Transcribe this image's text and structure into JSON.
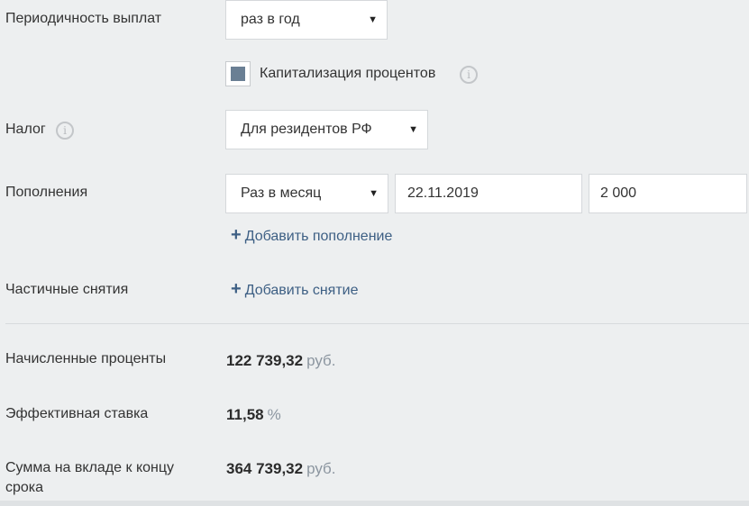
{
  "payout": {
    "label": "Периодичность выплат",
    "value": "раз в год"
  },
  "capitalization": {
    "label": "Капитализация процентов",
    "checked": true
  },
  "tax": {
    "label": "Налог",
    "value": "Для резидентов РФ"
  },
  "deposits": {
    "label": "Пополнения",
    "frequency": "Раз в месяц",
    "date": "22.11.2019",
    "amount": "2 000",
    "add_label": "Добавить пополнение"
  },
  "withdrawals": {
    "label": "Частичные снятия",
    "add_label": "Добавить снятие"
  },
  "results": {
    "interest": {
      "label": "Начисленные проценты",
      "value": "122 739,32",
      "unit": "руб."
    },
    "rate": {
      "label": "Эффективная ставка",
      "value": "11,58",
      "unit": "%"
    },
    "total": {
      "label_line1": "Сумма на вкладе к концу",
      "label_line2": "срока",
      "value": "364 739,32",
      "unit": "руб."
    }
  },
  "icons": {
    "info": "i",
    "dropdown": "▼",
    "plus": "+"
  }
}
